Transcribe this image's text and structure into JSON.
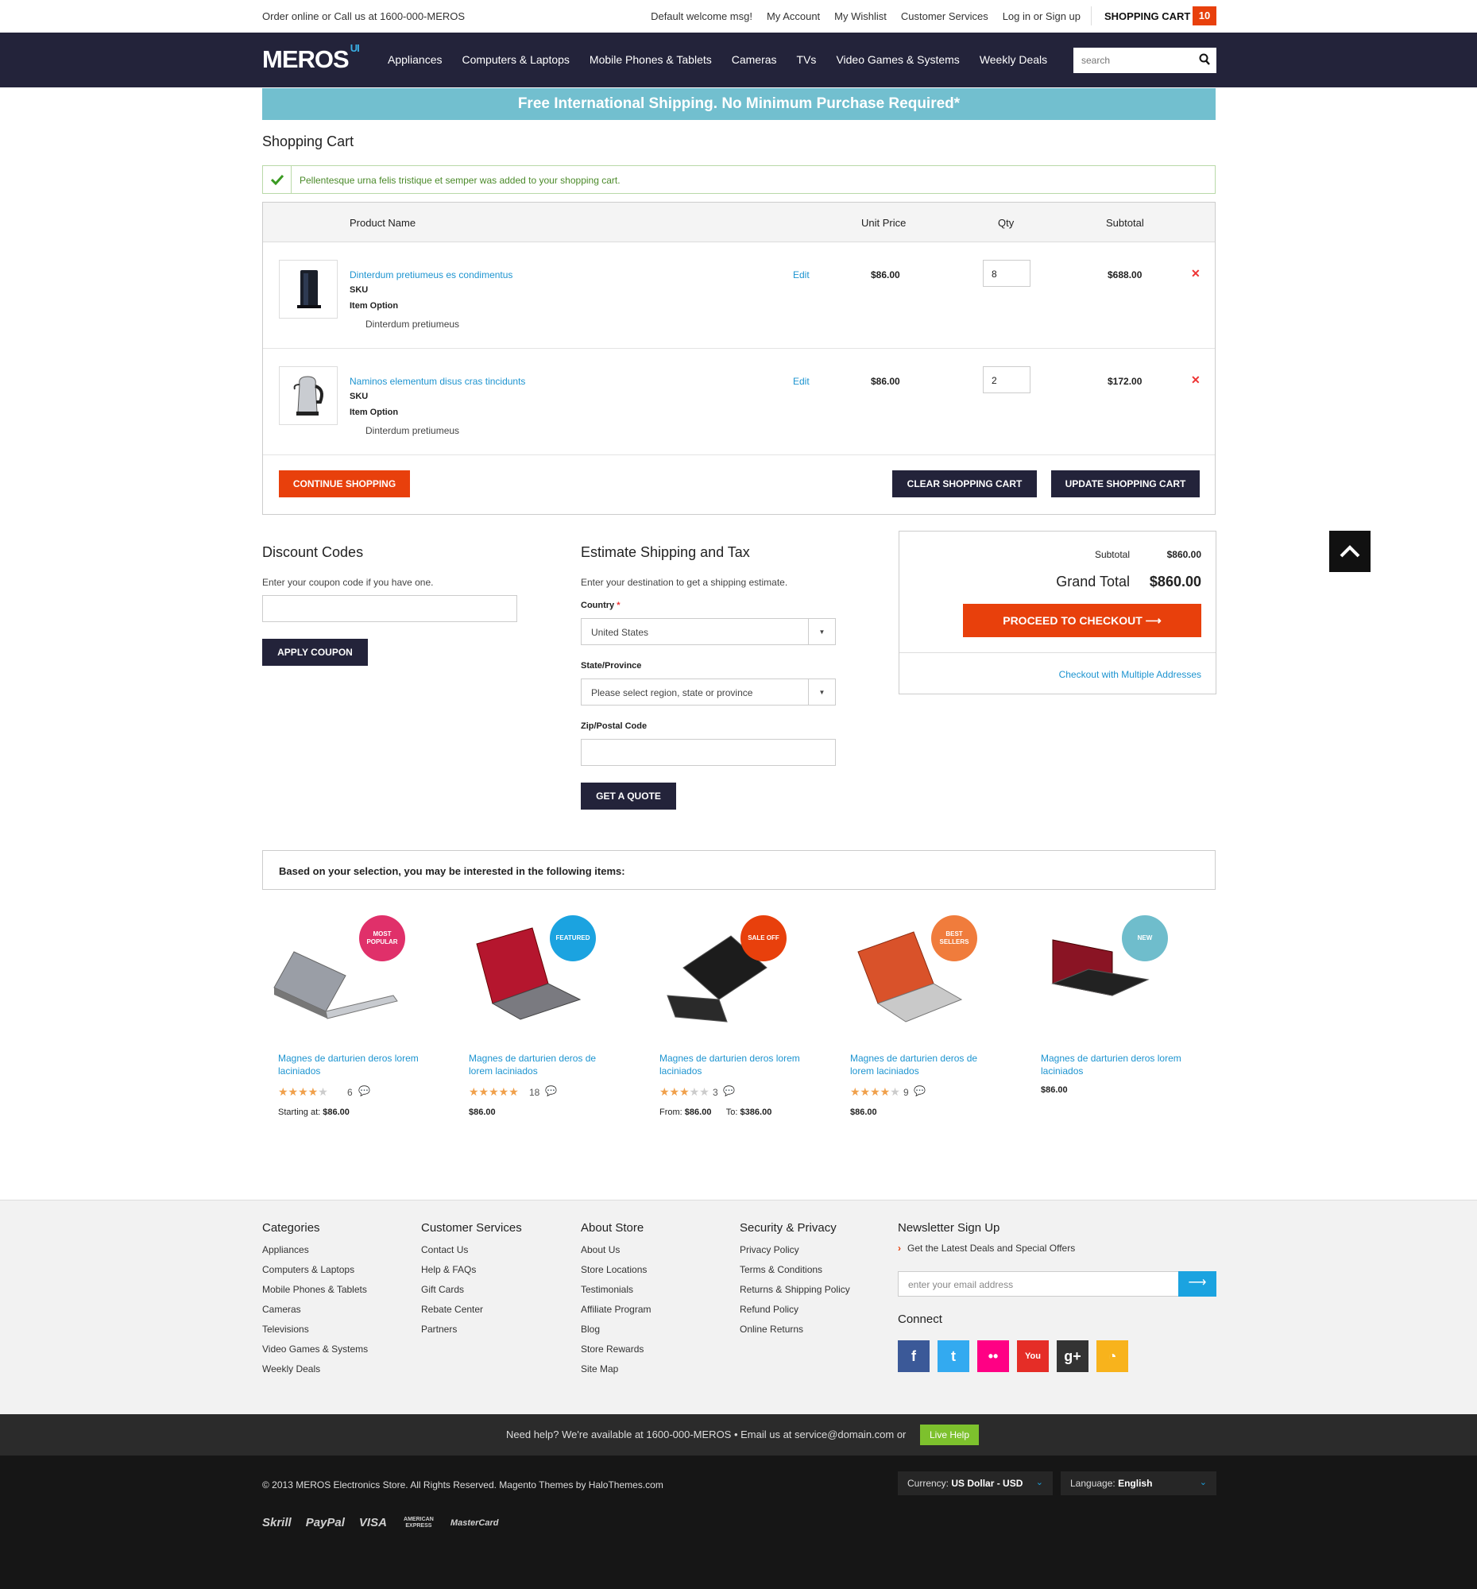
{
  "topbar": {
    "left_text": "Order online or Call us at 1600-000-MEROS",
    "links": [
      "Default welcome msg!",
      "My Account",
      "My Wishlist",
      "Customer Services",
      "Log in or Sign up"
    ],
    "cart_label": "SHOPPING CART",
    "cart_count": "10"
  },
  "nav": {
    "logo": "MEROS",
    "logo_sup": "UI",
    "items": [
      "Appliances",
      "Computers & Laptops",
      "Mobile Phones & Tablets",
      "Cameras",
      "TVs",
      "Video Games & Systems",
      "Weekly Deals"
    ],
    "search_placeholder": "search"
  },
  "banner": "Free International Shipping. No Minimum Purchase Required*",
  "page_title": "Shopping Cart",
  "success_message": "Pellentesque urna felis tristique et semper was added to your shopping cart.",
  "cart": {
    "headers": {
      "product": "Product Name",
      "unit_price": "Unit Price",
      "qty": "Qty",
      "subtotal": "Subtotal"
    },
    "rows": [
      {
        "name": "Dinterdum pretiumeus es condimentus",
        "sku_label": "SKU",
        "option_label": "Item Option",
        "option_value": "Dinterdum pretiumeus",
        "edit": "Edit",
        "unit_price": "$86.00",
        "qty": "8",
        "subtotal": "$688.00",
        "remove": "✕",
        "image": "desktop-tower"
      },
      {
        "name": "Naminos elementum disus cras tincidunts",
        "sku_label": "SKU",
        "option_label": "Item Option",
        "option_value": "Dinterdum pretiumeus",
        "edit": "Edit",
        "unit_price": "$86.00",
        "qty": "2",
        "subtotal": "$172.00",
        "remove": "✕",
        "image": "electric-kettle"
      }
    ],
    "continue_btn": "CONTINUE SHOPPING",
    "clear_btn": "CLEAR SHOPPING CART",
    "update_btn": "UPDATE SHOPPING CART"
  },
  "discount": {
    "title": "Discount Codes",
    "note": "Enter your coupon code if you have one.",
    "input_value": "",
    "button": "APPLY COUPON"
  },
  "shipping": {
    "title": "Estimate Shipping and Tax",
    "note": "Enter your destination to get a shipping estimate.",
    "country_label": "Country",
    "required_mark": "*",
    "country_value": "United States",
    "state_label": "State/Province",
    "state_value": "Please select region, state or province",
    "zip_label": "Zip/Postal Code",
    "zip_value": "",
    "button": "GET A QUOTE"
  },
  "totals": {
    "subtotal_label": "Subtotal",
    "subtotal_value": "$860.00",
    "grand_label": "Grand Total",
    "grand_value": "$860.00",
    "checkout_btn": "PROCEED TO CHECKOUT",
    "multi_link": "Checkout with Multiple Addresses"
  },
  "suggest_title": "Based on your selection, you may be interested in the following items:",
  "products": [
    {
      "badge": "MOST POPULAR",
      "badge_color": "#e0306a",
      "title": "Magnes de darturien deros lorem laciniados",
      "rating": 4,
      "reviews": "6",
      "price_prefix": "Starting at:",
      "price": "$86.00",
      "laptop_color": "#9a9ea6"
    },
    {
      "badge": "FEATURED",
      "badge_color": "#1ba3e0",
      "title": "Magnes de darturien deros de lorem laciniados",
      "rating": 5,
      "reviews": "18",
      "price_prefix": "",
      "price": "$86.00",
      "laptop_color": "#b5162e"
    },
    {
      "badge": "SALE OFF",
      "badge_color": "#e8400c",
      "title": "Magnes de darturien deros lorem laciniados",
      "rating": 3,
      "reviews": "3",
      "price_prefix": "From:",
      "price": "$86.00",
      "price_to_label": "To:",
      "price_to": "$386.00",
      "laptop_color": "#1c1c1c"
    },
    {
      "badge": "BEST SELLERS",
      "badge_color": "#f07c3c",
      "title": "Magnes de darturien deros de lorem laciniados",
      "rating": 4,
      "reviews": "9",
      "price_prefix": "",
      "price": "$86.00",
      "laptop_color": "#d9522a"
    },
    {
      "badge": "NEW",
      "badge_color": "#6fbdcc",
      "title": "Magnes de darturien deros lorem laciniados",
      "rating": 0,
      "reviews": "",
      "price_prefix": "",
      "price": "$86.00",
      "laptop_color": "#8a1424"
    }
  ],
  "footer": {
    "columns": [
      {
        "title": "Categories",
        "links": [
          "Appliances",
          "Computers & Laptops",
          "Mobile Phones & Tablets",
          "Cameras",
          "Televisions",
          "Video Games & Systems",
          "Weekly Deals"
        ]
      },
      {
        "title": "Customer Services",
        "links": [
          "Contact Us",
          "Help & FAQs",
          "Gift Cards",
          "Rebate Center",
          "Partners"
        ]
      },
      {
        "title": "About Store",
        "links": [
          "About Us",
          "Store Locations",
          "Testimonials",
          "Affiliate Program",
          "Blog",
          "Store Rewards",
          "Site Map"
        ]
      },
      {
        "title": "Security & Privacy",
        "links": [
          "Privacy Policy",
          "Terms & Conditions",
          "Returns & Shipping Policy",
          "Refund Policy",
          "Online Returns"
        ]
      }
    ],
    "newsletter_title": "Newsletter Sign Up",
    "newsletter_sub": "Get the Latest Deals and Special Offers",
    "newsletter_placeholder": "enter your email address",
    "connect_title": "Connect",
    "socials": [
      {
        "name": "facebook-icon",
        "glyph": "f",
        "color": "#3b5998"
      },
      {
        "name": "twitter-icon",
        "glyph": "t",
        "color": "#33aaf0"
      },
      {
        "name": "flickr-icon",
        "glyph": "••",
        "color": "#ff0084"
      },
      {
        "name": "youtube-icon",
        "glyph": "You",
        "color": "#e52d27"
      },
      {
        "name": "google-plus-icon",
        "glyph": "g+",
        "color": "#333333"
      },
      {
        "name": "rss-icon",
        "glyph": "◔",
        "color": "#f8b31c"
      }
    ]
  },
  "helpbar": {
    "text": "Need help? We're available at 1600-000-MEROS  •  Email us at service@domain.com or",
    "live_help": "Live Help"
  },
  "bottom": {
    "copyright": "© 2013 MEROS Electronics Store. All Rights Reserved. Magento Themes by HaloThemes.com",
    "currency_label": "Currency:",
    "currency_value": "US Dollar - USD",
    "language_label": "Language:",
    "language_value": "English",
    "payments": [
      "Skrill",
      "PayPal",
      "VISA",
      "AMERICAN EXPRESS",
      "MasterCard"
    ]
  }
}
